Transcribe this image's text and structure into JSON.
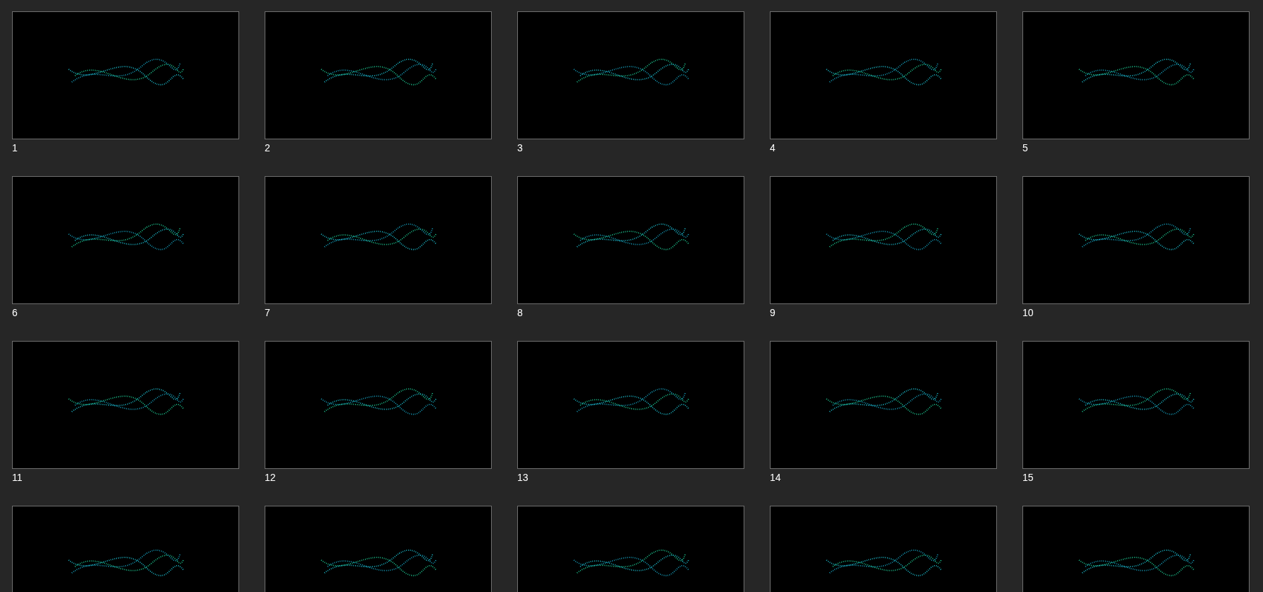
{
  "slides": [
    {
      "number": "1"
    },
    {
      "number": "2"
    },
    {
      "number": "3"
    },
    {
      "number": "4"
    },
    {
      "number": "5"
    },
    {
      "number": "6"
    },
    {
      "number": "7"
    },
    {
      "number": "8"
    },
    {
      "number": "9"
    },
    {
      "number": "10"
    },
    {
      "number": "11"
    },
    {
      "number": "12"
    },
    {
      "number": "13"
    },
    {
      "number": "14"
    },
    {
      "number": "15"
    },
    {
      "kind": "cut_off"
    },
    {
      "kind": "cut_off"
    },
    {
      "kind": "cut_off"
    },
    {
      "kind": "cut_off"
    },
    {
      "kind": "cut_off"
    }
  ]
}
